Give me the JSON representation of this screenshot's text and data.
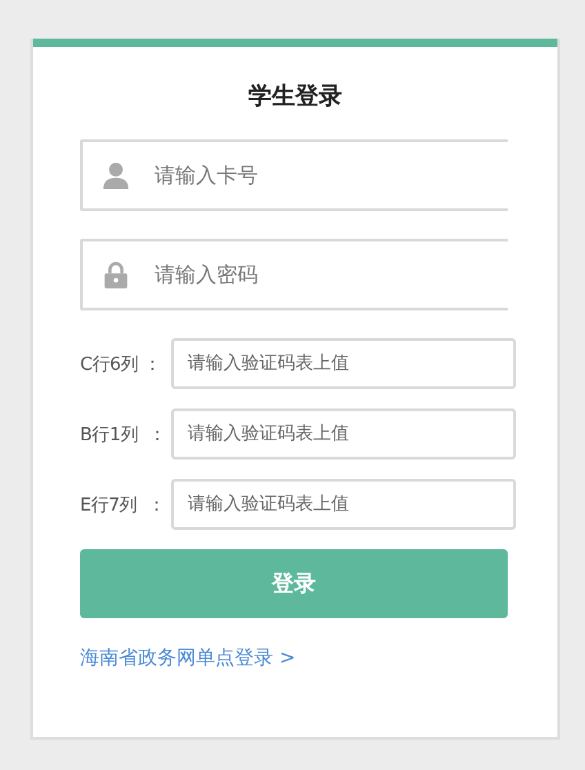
{
  "title": "学生登录",
  "fields": [
    {
      "kind": "user",
      "placeholder": "请输入卡号"
    },
    {
      "kind": "lock",
      "placeholder": "请输入密码"
    }
  ],
  "captcha": [
    {
      "label": "C行6列 ：",
      "placeholder": "请输入验证码表上值"
    },
    {
      "label": "B行1列  ：",
      "placeholder": "请输入验证码表上值"
    },
    {
      "label": "E行7列  ：",
      "placeholder": "请输入验证码表上值"
    }
  ],
  "submit": "登录",
  "sso_link": "海南省政务网单点登录 >"
}
